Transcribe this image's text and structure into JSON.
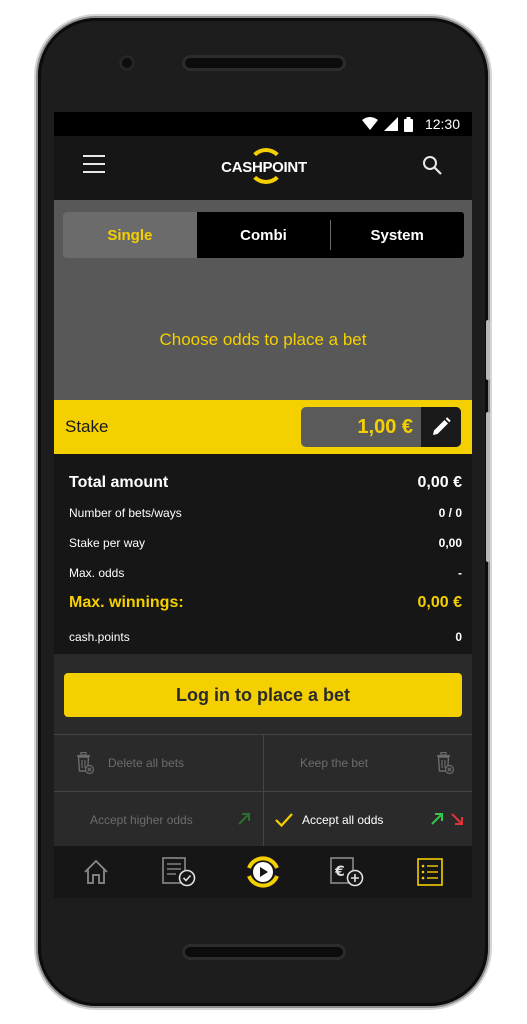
{
  "status_bar": {
    "time": "12:30"
  },
  "app_bar": {
    "brand": "CASHPOINT"
  },
  "bet_tabs": [
    {
      "label": "Single",
      "active": true
    },
    {
      "label": "Combi",
      "active": false
    },
    {
      "label": "System",
      "active": false
    }
  ],
  "empty_message": "Choose odds to place a bet",
  "stake": {
    "label": "Stake",
    "value": "1,00 €"
  },
  "summary": {
    "total_amount_label": "Total amount",
    "total_amount_value": "0,00 €",
    "bets_ways_label": "Number of bets/ways",
    "bets_ways_value": "0 / 0",
    "stake_per_way_label": "Stake per way",
    "stake_per_way_value": "0,00",
    "max_odds_label": "Max. odds",
    "max_odds_value": "-",
    "max_winnings_label": "Max. winnings:",
    "max_winnings_value": "0,00 €",
    "cash_points_label": "cash.points",
    "cash_points_value": "0"
  },
  "login_button": "Log in to place a bet",
  "options": {
    "delete_all": "Delete all bets",
    "keep_bet": "Keep the bet",
    "accept_higher": "Accept higher odds",
    "accept_all": "Accept all odds",
    "accept_all_checked": true
  },
  "colors": {
    "accent": "#f5d000",
    "odds_up": "#33c84a",
    "odds_down": "#e2333a"
  },
  "bottom_nav": [
    {
      "icon": "home-icon"
    },
    {
      "icon": "my-bets-icon"
    },
    {
      "icon": "live-play-icon"
    },
    {
      "icon": "deposit-icon"
    },
    {
      "icon": "betslip-icon",
      "active": true
    }
  ]
}
